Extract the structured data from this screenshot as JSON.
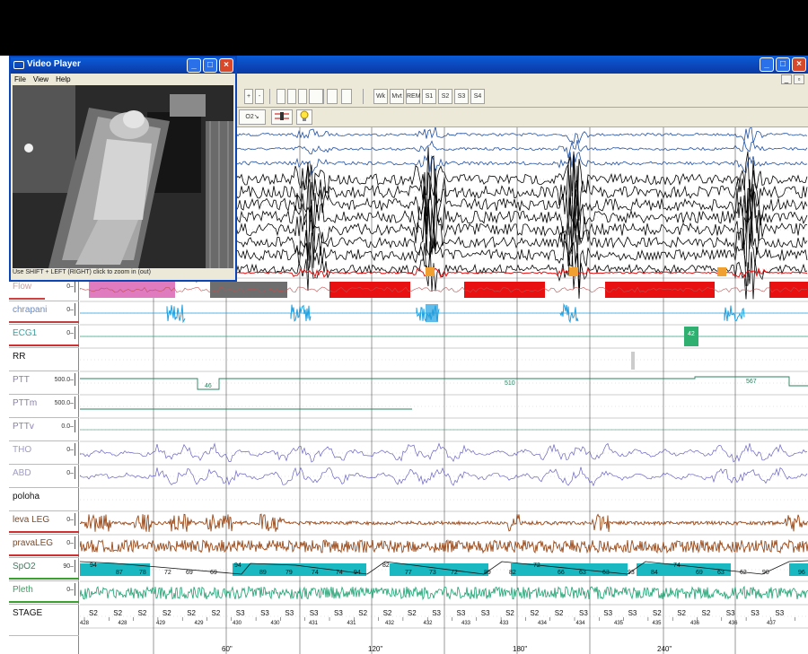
{
  "video_player": {
    "title": "Video Player",
    "menu": [
      "File",
      "View",
      "Help"
    ],
    "status": "Use SHIFT + LEFT (RIGHT) click to zoom in (out)"
  },
  "toolbar": {
    "buttons": [
      "+",
      "-",
      "",
      "",
      "",
      "",
      "",
      "",
      "Wk",
      "Mvt",
      "REM",
      "S1",
      "S2",
      "S3",
      "S4"
    ],
    "second_row": [
      "O2↘",
      "",
      ""
    ]
  },
  "channels": [
    {
      "name": "Flow",
      "scale": "0–",
      "color": "#c9a0a0",
      "bar": "#d04040"
    },
    {
      "name": "chrapani",
      "scale": "0–",
      "color": "#6a8abf",
      "bar": "#c04040"
    },
    {
      "name": "ECG1",
      "scale": "0–",
      "color": "#3aa0a0",
      "bar": "#d03030"
    },
    {
      "name": "RR",
      "scale": "",
      "color": "#222"
    },
    {
      "name": "PTT",
      "scale": "500.0–",
      "color": "#8a7db0"
    },
    {
      "name": "PTTm",
      "scale": "500.0–",
      "color": "#8a7db0"
    },
    {
      "name": "PTTv",
      "scale": "0.0–",
      "color": "#8a7db0"
    },
    {
      "name": "THO",
      "scale": "0–",
      "color": "#9e9ac8"
    },
    {
      "name": "ABD",
      "scale": "0–",
      "color": "#9e9ac8"
    },
    {
      "name": "poloha",
      "scale": "",
      "color": "#222"
    },
    {
      "name": "leva LEG",
      "scale": "0–",
      "color": "#7a4a2a",
      "bar": "#d03030"
    },
    {
      "name": "pravaLEG",
      "scale": "0–",
      "color": "#7a4a2a",
      "bar": "#d03030"
    },
    {
      "name": "SpO2",
      "scale": "90–",
      "color": "#3a8060",
      "bar": "#3aa030"
    },
    {
      "name": "Pleth",
      "scale": "0–",
      "color": "#3aa060",
      "bar": "#3aa030"
    },
    {
      "name": "STAGE",
      "scale": "",
      "color": "#222"
    }
  ],
  "ptt_values": [
    "46",
    "510",
    "567"
  ],
  "ecg_marker": "42",
  "spo2_values": [
    "94",
    "87",
    "78",
    "72",
    "69",
    "69",
    "94",
    "89",
    "79",
    "74",
    "74",
    "94",
    "82",
    "77",
    "73",
    "72",
    "89",
    "82",
    "72",
    "66",
    "63",
    "63",
    "93",
    "84",
    "74",
    "69",
    "63",
    "62",
    "90",
    "96"
  ],
  "stages": [
    "S2",
    "S2",
    "S2",
    "S2",
    "S2",
    "S2",
    "S3",
    "S3",
    "S3",
    "S3",
    "S3",
    "S2",
    "S2",
    "S2",
    "S3",
    "S3",
    "S3",
    "S2",
    "S2",
    "S2",
    "S3",
    "S3",
    "S3",
    "S2",
    "S2",
    "S2",
    "S3",
    "S3",
    "S3"
  ],
  "epochs": [
    "428",
    "428",
    "429",
    "429",
    "430",
    "430",
    "431",
    "431",
    "432",
    "432",
    "433",
    "433",
    "434",
    "434",
    "435",
    "435",
    "436",
    "436",
    "437"
  ],
  "time_axis": [
    "60\"",
    "120\"",
    "180\"",
    "240\""
  ],
  "colors": {
    "flow_pink": "#e07bc0",
    "flow_gray": "#6e6e6e",
    "flow_red": "#e81010",
    "snore_blue": "#20a0e0",
    "ecg_green": "#30b070",
    "spo2_teal": "#1ab8c0",
    "pleth_green": "#1aa070",
    "leg_brown": "#9a4a1a",
    "eeg_black": "#000"
  }
}
